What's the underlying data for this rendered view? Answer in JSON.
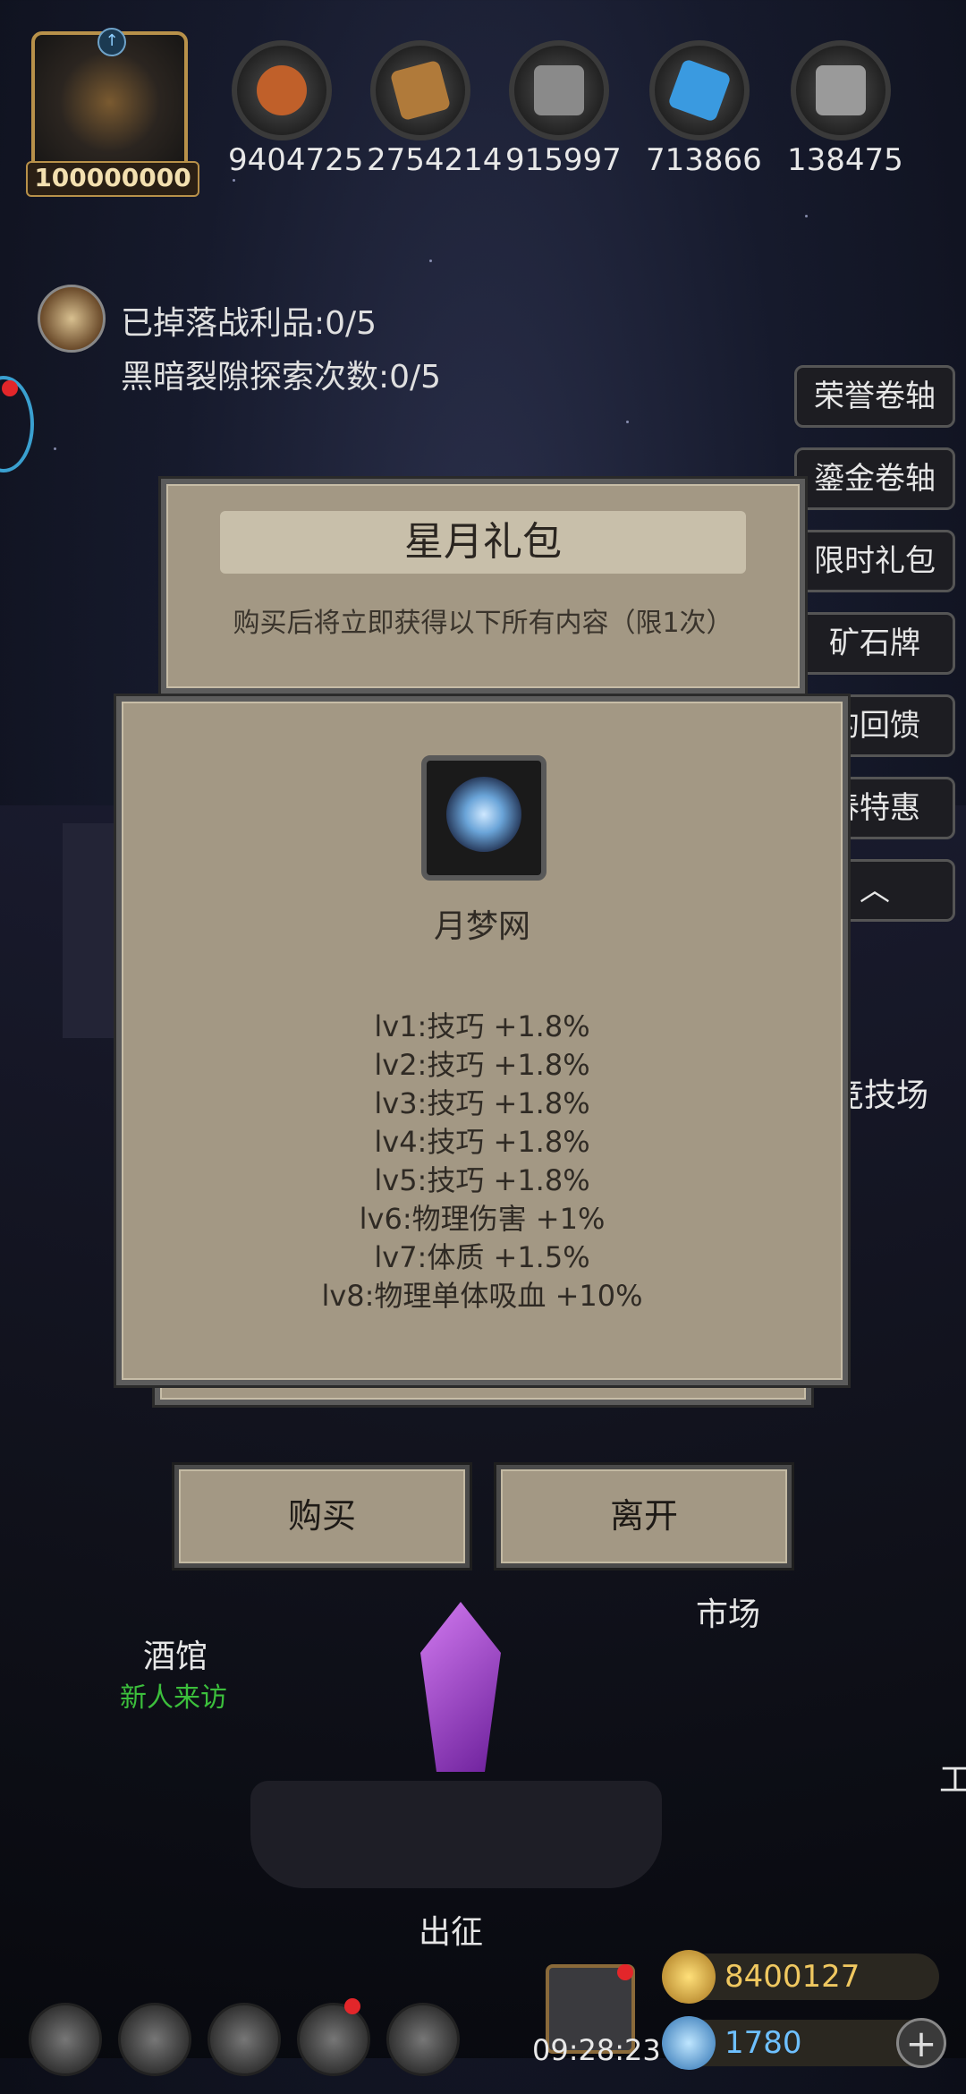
{
  "profile": {
    "power": "100000000"
  },
  "resources": [
    {
      "icon": "meat-icon",
      "value": "9404725",
      "color": "#c0602a"
    },
    {
      "icon": "wood-icon",
      "value": "2754214",
      "color": "#b07a3a"
    },
    {
      "icon": "iron-icon",
      "value": "915997",
      "color": "#8a8a8a"
    },
    {
      "icon": "crystal-icon",
      "value": "713866",
      "color": "#3a9ae0"
    },
    {
      "icon": "steel-icon",
      "value": "138475",
      "color": "#9a9a9a"
    }
  ],
  "quests": {
    "loot": "已掉落战利品:0/5",
    "rift": "黑暗裂隙探索次数:0/5"
  },
  "side_menu": [
    "荣誉卷轴",
    "鎏金卷轴",
    "限时礼包",
    "矿石牌",
    "的回馈",
    "春特惠"
  ],
  "pack_dialog": {
    "title": "星月礼包",
    "subtitle": "购买后将立即获得以下所有内容（限1次）"
  },
  "item_dialog": {
    "item_icon": "moon-dream-net-icon",
    "item_name": "月梦网",
    "attributes": [
      "lv1:技巧 +1.8%",
      "lv2:技巧 +1.8%",
      "lv3:技巧 +1.8%",
      "lv4:技巧 +1.8%",
      "lv5:技巧 +1.8%",
      "lv6:物理伤害 +1%",
      "lv7:体质 +1.5%",
      "lv8:物理单体吸血 +10%"
    ]
  },
  "buttons": {
    "buy": "购买",
    "leave": "离开"
  },
  "town": {
    "arena": "竞技场",
    "market": "市场",
    "tavern": "酒馆",
    "tavern_sub": "新人来访",
    "expedition": "出征",
    "workshop_partial": "工"
  },
  "currency": {
    "gold": "8400127",
    "gem": "1780"
  },
  "clock": "09:28:23"
}
